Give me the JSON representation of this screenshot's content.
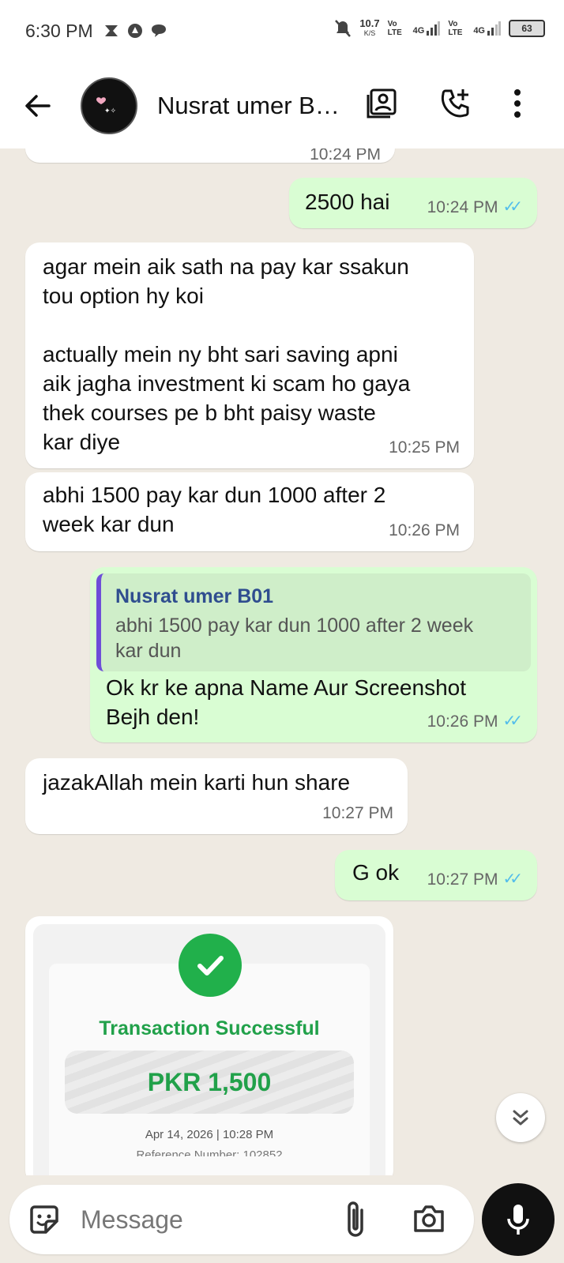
{
  "status_bar": {
    "time": "6:30 PM",
    "speed": "10.7",
    "speed_unit": "K/S",
    "sim1": "Vo LTE",
    "net1": "4G",
    "sim2": "Vo LTE",
    "net2": "4G",
    "battery": "63"
  },
  "header": {
    "contact_name": "Nusrat umer B…"
  },
  "messages": [
    {
      "direction": "out",
      "text": "2500 hai",
      "time": "10:24 PM"
    },
    {
      "direction": "in",
      "text": "agar mein aik sath na pay kar ssakun\ntou option hy koi\n\nactually mein ny bht sari saving apni\naik jagha investment ki scam ho gaya\nthek courses pe b bht paisy waste\nkar diye",
      "time": "10:25 PM"
    },
    {
      "direction": "in",
      "text": "abhi 1500 pay kar dun 1000 after 2\nweek kar dun",
      "time": "10:26 PM"
    },
    {
      "direction": "out",
      "quote_name": "Nusrat umer B01",
      "quote_text": "abhi 1500 pay kar dun 1000 after 2 week\nkar dun",
      "text": "Ok kr ke apna Name Aur Screenshot\nBejh den!",
      "time": "10:26 PM"
    },
    {
      "direction": "in",
      "text": "jazakAllah mein karti hun share",
      "time": "10:27 PM"
    },
    {
      "direction": "out",
      "text": "G ok",
      "time": "10:27 PM"
    }
  ],
  "partial_top_time": "10:24 PM",
  "transaction": {
    "title": "Transaction Successful",
    "amount": "PKR 1,500",
    "date": "Apr 14, 2026 | 10:28 PM",
    "reference": "Reference Number: 102852"
  },
  "composer": {
    "placeholder": "Message"
  },
  "colors": {
    "chat_background": "#efeae2",
    "outgoing_bubble": "#d9fdd3",
    "incoming_bubble": "#ffffff",
    "read_ticks": "#53bdeb",
    "success_green": "#21b04b"
  }
}
